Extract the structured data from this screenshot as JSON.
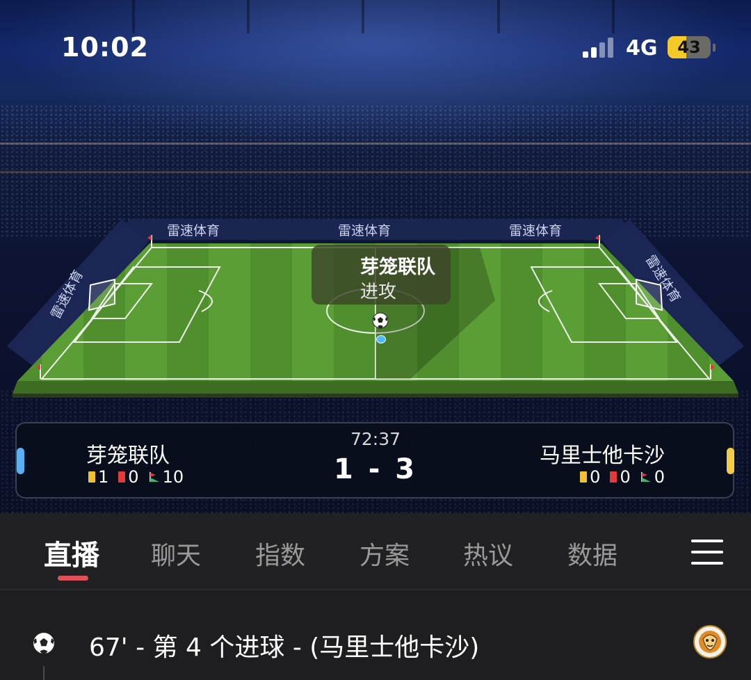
{
  "status_bar": {
    "time": "10:02",
    "network": "4G",
    "battery": "43",
    "battery_level": 0.43
  },
  "pitch": {
    "ad_text": "雷速体育",
    "possession_team": "芽笼联队",
    "possession_action": "进攻"
  },
  "match": {
    "clock": "72:37",
    "score": "1 - 3",
    "home": {
      "name": "芽笼联队",
      "color": "#5ab0f0",
      "yellow_cards": "1",
      "red_cards": "0",
      "corners": "10"
    },
    "away": {
      "name": "马里士他卡沙",
      "color": "#f2cc48",
      "yellow_cards": "0",
      "red_cards": "0",
      "corners": "0"
    }
  },
  "tabs": [
    {
      "label": "直播",
      "active": true
    },
    {
      "label": "聊天"
    },
    {
      "label": "指数"
    },
    {
      "label": "方案"
    },
    {
      "label": "热议"
    },
    {
      "label": "数据"
    }
  ],
  "events": [
    {
      "text": "67' - 第 4 个进球 - (马里士他卡沙)",
      "icon": "soccer-ball-icon"
    }
  ],
  "colors": {
    "yellow_card": "#f2c133",
    "red_card": "#e33b3b",
    "tab_indicator": "#e0505c"
  }
}
